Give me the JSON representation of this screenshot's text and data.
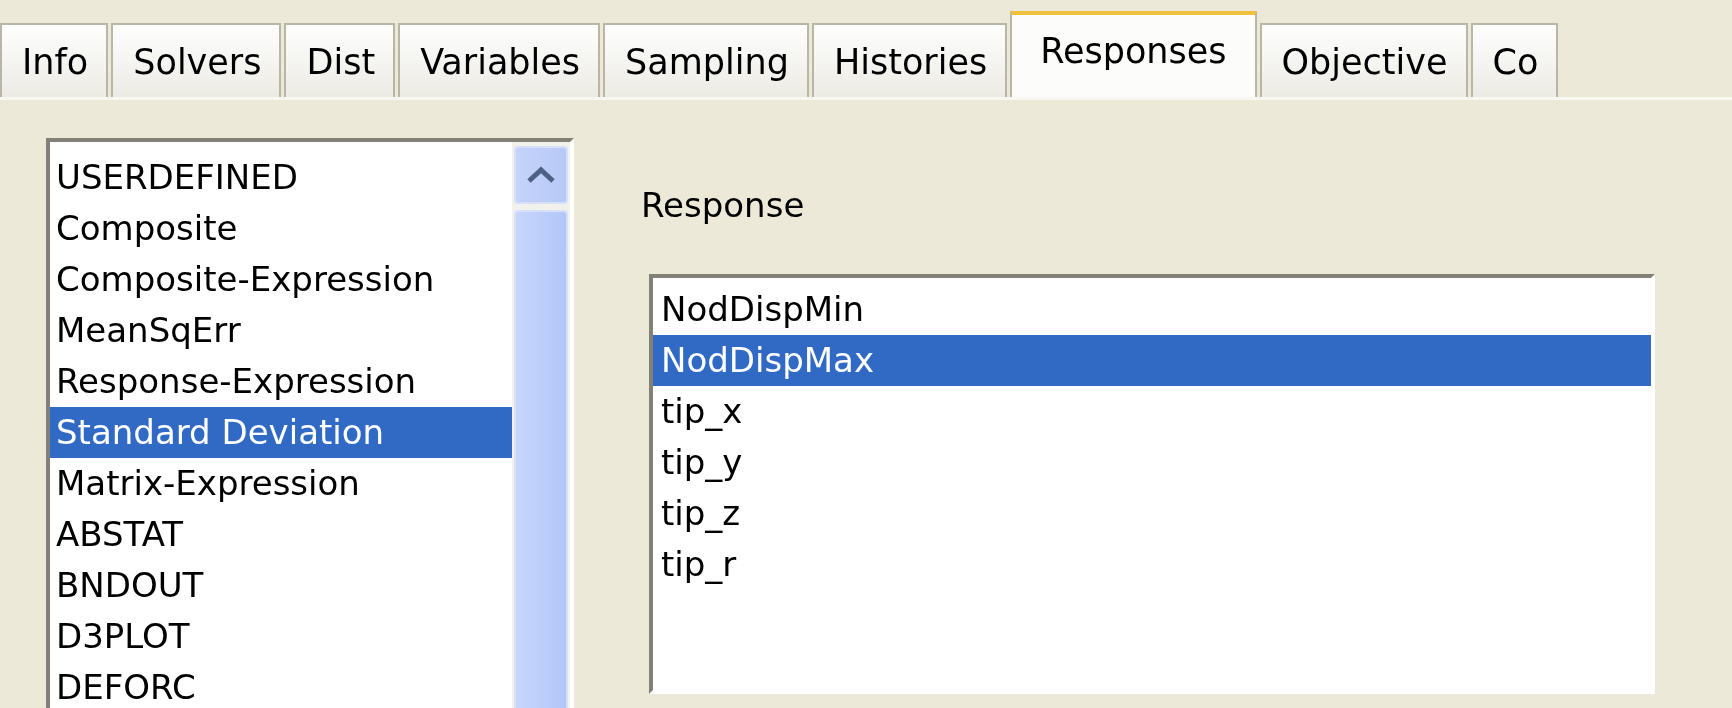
{
  "tabs": [
    {
      "label": "Info",
      "selected": false
    },
    {
      "label": "Solvers",
      "selected": false
    },
    {
      "label": "Dist",
      "selected": false
    },
    {
      "label": "Variables",
      "selected": false
    },
    {
      "label": "Sampling",
      "selected": false
    },
    {
      "label": "Histories",
      "selected": false
    },
    {
      "label": "Responses",
      "selected": true
    },
    {
      "label": "Objective",
      "selected": false
    },
    {
      "label": "Co",
      "selected": false
    }
  ],
  "response_types": [
    {
      "label": "USERDEFINED",
      "selected": false
    },
    {
      "label": "Composite",
      "selected": false
    },
    {
      "label": "Composite-Expression",
      "selected": false
    },
    {
      "label": "MeanSqErr",
      "selected": false
    },
    {
      "label": "Response-Expression",
      "selected": false
    },
    {
      "label": "Standard Deviation",
      "selected": true
    },
    {
      "label": "Matrix-Expression",
      "selected": false
    },
    {
      "label": "ABSTAT",
      "selected": false
    },
    {
      "label": "BNDOUT",
      "selected": false
    },
    {
      "label": "D3PLOT",
      "selected": false
    },
    {
      "label": "DEFORC",
      "selected": false
    }
  ],
  "response": {
    "label": "Response",
    "items": [
      {
        "label": "NodDispMin",
        "selected": false
      },
      {
        "label": "NodDispMax",
        "selected": true
      },
      {
        "label": "tip_x",
        "selected": false
      },
      {
        "label": "tip_y",
        "selected": false
      },
      {
        "label": "tip_z",
        "selected": false
      },
      {
        "label": "tip_r",
        "selected": false
      }
    ]
  }
}
